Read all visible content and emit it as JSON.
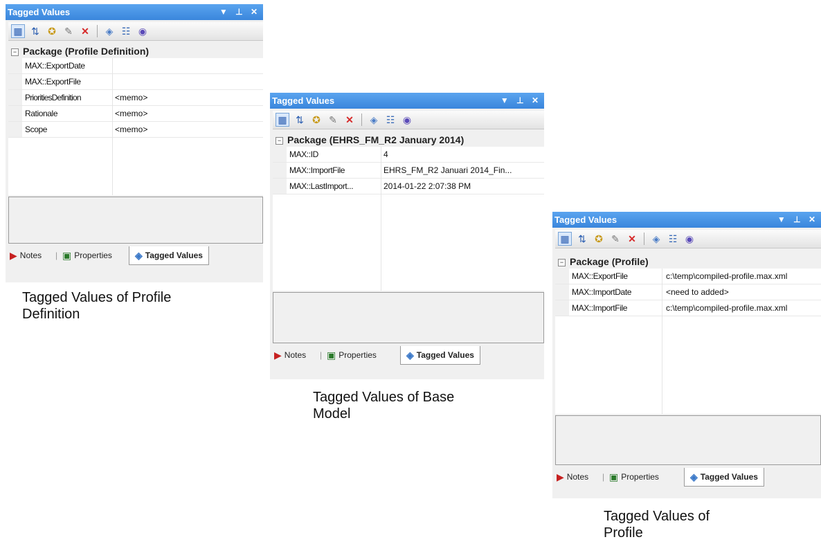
{
  "panels": [
    {
      "title": "Tagged Values",
      "group": "Package (Profile Definition)",
      "rows": [
        {
          "name": "MAX::ExportDate",
          "value": ""
        },
        {
          "name": "MAX::ExportFile",
          "value": ""
        },
        {
          "name": "PrioritiesDefinition",
          "value": "<memo>"
        },
        {
          "name": "Rationale",
          "value": "<memo>"
        },
        {
          "name": "Scope",
          "value": "<memo>"
        }
      ],
      "tabs": {
        "notes": "Notes",
        "properties": "Properties",
        "tagged": "Tagged Values"
      },
      "caption": [
        "Tagged Values of Profile",
        "Definition"
      ]
    },
    {
      "title": "Tagged Values",
      "group": "Package (EHRS_FM_R2 January 2014)",
      "rows": [
        {
          "name": "MAX::ID",
          "value": "4"
        },
        {
          "name": "MAX::ImportFile",
          "value": "EHRS_FM_R2 Januari 2014_Fin..."
        },
        {
          "name": "MAX::LastImport...",
          "value": "2014-01-22 2:07:38 PM"
        }
      ],
      "tabs": {
        "notes": "Notes",
        "properties": "Properties",
        "tagged": "Tagged Values"
      },
      "caption": [
        "Tagged Values of Base",
        "Model"
      ]
    },
    {
      "title": "Tagged Values",
      "group": "Package (Profile)",
      "rows": [
        {
          "name": "MAX::ExportFile",
          "value": "c:\\temp\\compiled-profile.max.xml"
        },
        {
          "name": "MAX::ImportDate",
          "value": "<need to added>"
        },
        {
          "name": "MAX::ImportFile",
          "value": "c:\\temp\\compiled-profile.max.xml"
        }
      ],
      "tabs": {
        "notes": "Notes",
        "properties": "Properties",
        "tagged": "Tagged Values"
      },
      "caption": [
        "Tagged Values of",
        "Profile"
      ]
    }
  ],
  "controls": {
    "dropdown": "▼",
    "pin": "⊥",
    "close": "✕"
  }
}
